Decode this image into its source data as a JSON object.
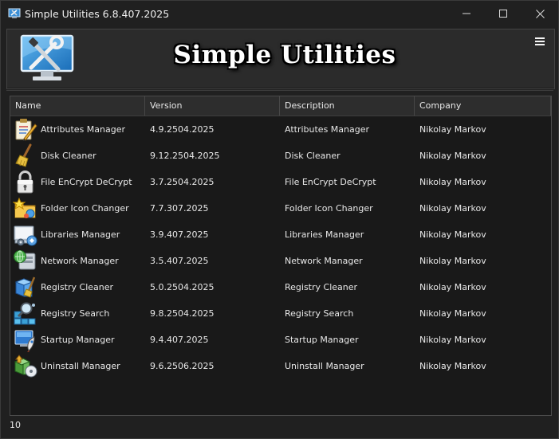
{
  "window": {
    "title": "Simple Utilities 6.8.407.2025"
  },
  "banner": {
    "title": "Simple Utilities"
  },
  "list": {
    "columns": [
      "Name",
      "Version",
      "Description",
      "Company"
    ],
    "rows": [
      {
        "icon": "attributes-icon",
        "name": "Attributes Manager",
        "version": "4.9.2504.2025",
        "description": "Attributes Manager",
        "company": "Nikolay Markov"
      },
      {
        "icon": "broom-icon",
        "name": "Disk Cleaner",
        "version": "9.12.2504.2025",
        "description": "Disk Cleaner",
        "company": "Nikolay Markov"
      },
      {
        "icon": "padlock-icon",
        "name": "File EnCrypt DeCrypt",
        "version": "3.7.2504.2025",
        "description": "File EnCrypt DeCrypt",
        "company": "Nikolay Markov"
      },
      {
        "icon": "folder-icon",
        "name": "Folder Icon Changer",
        "version": "7.7.307.2025",
        "description": "Folder Icon Changer",
        "company": "Nikolay Markov"
      },
      {
        "icon": "libraries-icon",
        "name": "Libraries Manager",
        "version": "3.9.407.2025",
        "description": "Libraries Manager",
        "company": "Nikolay Markov"
      },
      {
        "icon": "network-icon",
        "name": "Network Manager",
        "version": "3.5.407.2025",
        "description": "Network Manager",
        "company": "Nikolay Markov"
      },
      {
        "icon": "registry-cleaner-icon",
        "name": "Registry Cleaner",
        "version": "5.0.2504.2025",
        "description": "Registry Cleaner",
        "company": "Nikolay Markov"
      },
      {
        "icon": "registry-search-icon",
        "name": "Registry Search",
        "version": "9.8.2504.2025",
        "description": "Registry Search",
        "company": "Nikolay Markov"
      },
      {
        "icon": "startup-icon",
        "name": "Startup Manager",
        "version": "9.4.407.2025",
        "description": "Startup Manager",
        "company": "Nikolay Markov"
      },
      {
        "icon": "uninstall-icon",
        "name": "Uninstall Manager",
        "version": "9.6.2506.2025",
        "description": "Uninstall Manager",
        "company": "Nikolay Markov"
      }
    ]
  },
  "status": {
    "count": "10"
  },
  "colors": {
    "background": "#202020",
    "list_background": "#191919",
    "header": "#2d2d2d",
    "text": "#e8e8e8"
  }
}
